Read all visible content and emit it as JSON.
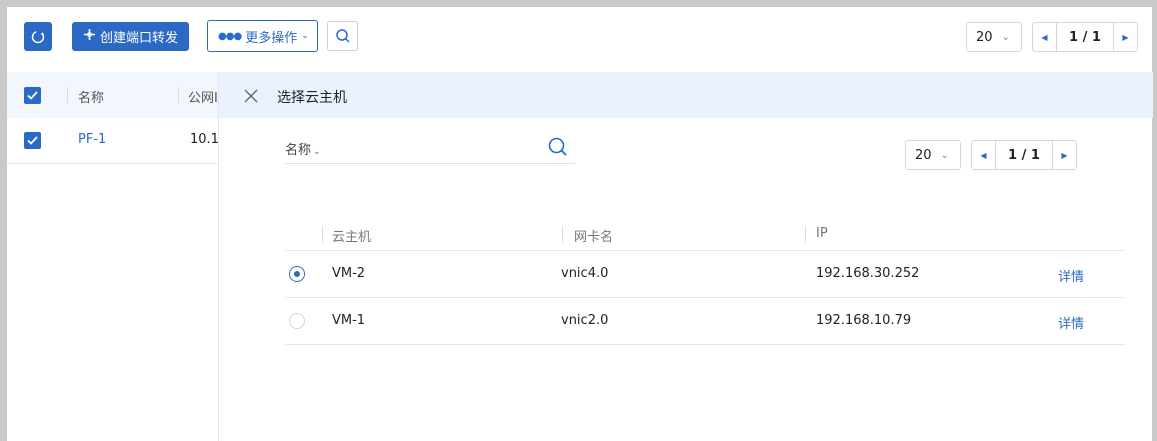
{
  "toolbar": {
    "refresh_icon": "refresh-icon",
    "create_label": "创建端口转发",
    "more_label": "更多操作",
    "search_icon": "search-icon"
  },
  "top_pager": {
    "page_size": "20",
    "page_info": "1 / 1"
  },
  "left_table": {
    "headers": [
      "名称",
      "公网I"
    ],
    "rows": [
      {
        "name": "PF-1",
        "public_ip": "10.1!"
      }
    ]
  },
  "panel": {
    "title": "选择云主机",
    "filter_label": "名称",
    "pager": {
      "page_size": "20",
      "page_info": "1 / 1"
    },
    "columns": [
      "云主机",
      "网卡名",
      "IP"
    ],
    "rows": [
      {
        "selected": true,
        "vm": "VM-2",
        "nic": "vnic4.0",
        "ip": "192.168.30.252",
        "action": "详情"
      },
      {
        "selected": false,
        "vm": "VM-1",
        "nic": "vnic2.0",
        "ip": "192.168.10.79",
        "action": "详情"
      }
    ]
  },
  "colors": {
    "accent": "#2b6ac4",
    "header_bg": "#f2f7fd",
    "panel_header_bg": "#eaf3fd"
  }
}
